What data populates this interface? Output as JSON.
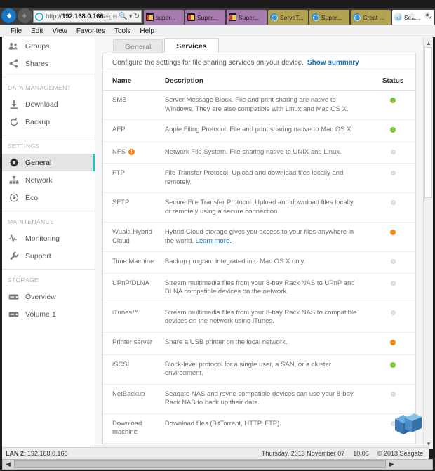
{
  "browser": {
    "back_label": "Back",
    "forward_label": "Forward",
    "url_scheme": "http://",
    "url_host": "192.168.0.166",
    "url_path": "/#general",
    "search_icon": "search-icon",
    "dropdown_icon": "chevron-down-icon",
    "refresh_icon": "refresh-icon",
    "tabs": [
      {
        "label": "super...",
        "color": "purple",
        "icon": "shopping-bag-icon",
        "active": false
      },
      {
        "label": "Super...",
        "color": "purple",
        "icon": "shopping-bag-icon",
        "active": false
      },
      {
        "label": "Super...",
        "color": "purple",
        "icon": "shopping-bag-icon",
        "active": false
      },
      {
        "label": "ServeT...",
        "color": "olive",
        "icon": "globe-icon",
        "active": false
      },
      {
        "label": "Super...",
        "color": "olive",
        "icon": "globe-icon",
        "active": false
      },
      {
        "label": "Great ...",
        "color": "olive",
        "icon": "globe-icon",
        "active": false
      },
      {
        "label": "Sea...",
        "color": "white",
        "icon": "globe-icon",
        "active": true,
        "close": "×"
      }
    ],
    "tools": [
      {
        "name": "home-icon",
        "label": "Home"
      },
      {
        "name": "favorites-star-icon",
        "label": "Favorites"
      },
      {
        "name": "settings-gear-icon",
        "label": "Tools"
      }
    ],
    "menu": [
      "File",
      "Edit",
      "View",
      "Favorites",
      "Tools",
      "Help"
    ]
  },
  "sidebar": {
    "items": [
      {
        "type": "item",
        "label": "Groups",
        "icon": "groups-icon",
        "selected": false
      },
      {
        "type": "item",
        "label": "Shares",
        "icon": "share-icon",
        "selected": false
      },
      {
        "type": "sep"
      },
      {
        "type": "group",
        "label": "DATA MANAGEMENT"
      },
      {
        "type": "item",
        "label": "Download",
        "icon": "download-icon",
        "selected": false
      },
      {
        "type": "item",
        "label": "Backup",
        "icon": "backup-icon",
        "selected": false
      },
      {
        "type": "sep"
      },
      {
        "type": "group",
        "label": "SETTINGS"
      },
      {
        "type": "item",
        "label": "General",
        "icon": "gear-icon",
        "selected": true
      },
      {
        "type": "item",
        "label": "Network",
        "icon": "network-icon",
        "selected": false
      },
      {
        "type": "item",
        "label": "Eco",
        "icon": "eco-icon",
        "selected": false
      },
      {
        "type": "sep"
      },
      {
        "type": "group",
        "label": "MAINTENANCE"
      },
      {
        "type": "item",
        "label": "Monitoring",
        "icon": "monitoring-icon",
        "selected": false
      },
      {
        "type": "item",
        "label": "Support",
        "icon": "wrench-icon",
        "selected": false
      },
      {
        "type": "sep"
      },
      {
        "type": "group",
        "label": "STORAGE"
      },
      {
        "type": "item",
        "label": "Overview",
        "icon": "storage-icon",
        "selected": false
      },
      {
        "type": "item",
        "label": "Volume 1",
        "icon": "storage-icon",
        "selected": false
      }
    ]
  },
  "main": {
    "tabs": [
      {
        "label": "General",
        "active": false
      },
      {
        "label": "Services",
        "active": true
      }
    ],
    "description": "Configure the settings for file sharing services on your device.",
    "summary_link": "Show summary",
    "table": {
      "headers": [
        "Name",
        "Description",
        "Status"
      ],
      "rows": [
        {
          "name": "SMB",
          "description": "Server Message Block. File and print sharing are native to Windows. They are also compatible with Linux and Mac OS X.",
          "status": "green"
        },
        {
          "name": "AFP",
          "description": "Apple Filing Protocol. File and print sharing native to Mac OS X.",
          "status": "green"
        },
        {
          "name": "NFS",
          "warning": "!",
          "description": "Network File System. File sharing native to UNIX and Linux.",
          "status": "grey"
        },
        {
          "name": "FTP",
          "description": "File Transfer Protocol. Upload and download files locally and remotely.",
          "status": "grey"
        },
        {
          "name": "SFTP",
          "description": "Secure File Transfer Protocol. Upload and download files locally or remotely using a secure connection.",
          "status": "grey"
        },
        {
          "name": "Wuala Hybrid Cloud",
          "description": "Hybrid Cloud storage gives you access to your files anywhere in the world.",
          "link": "Learn more.",
          "status": "orange"
        },
        {
          "name": "Time Machine",
          "description": "Backup program integrated into Mac OS X only.",
          "status": "grey"
        },
        {
          "name": "UPnP/DLNA",
          "description": "Stream multimedia files from your 8-bay Rack NAS to UPnP and DLNA compatible devices on the network.",
          "status": "grey"
        },
        {
          "name": "iTunes™",
          "description": "Stream multimedia files from your 8-bay Rack NAS to compatible devices on the network using iTunes.",
          "status": "grey"
        },
        {
          "name": "Printer server",
          "description": "Share a USB printer on the local network.",
          "status": "orange"
        },
        {
          "name": "iSCSI",
          "description": "Block-level protocol for a single user, a SAN, or a cluster environment.",
          "status": "green"
        },
        {
          "name": "NetBackup",
          "description": "Seagate NAS and rsync-compatible devices can use your 8-bay Rack NAS to back up their data.",
          "status": "grey"
        },
        {
          "name": "Download machine",
          "description": "Download files (BitTorrent, HTTP, FTP).",
          "status": "grey"
        }
      ]
    }
  },
  "status_bar": {
    "lan_label": "LAN 2",
    "lan_value": ": 192.168.0.166",
    "date": "Thursday, 2013 November 07",
    "time": "10:06",
    "copyright": "© 2013 Seagate"
  },
  "watermark": {
    "name": "tweaktown-logo",
    "text": "TT"
  },
  "colors": {
    "accent_teal": "#27c2c8",
    "status_green": "#7cc242",
    "status_orange": "#f08a18",
    "status_grey": "#e2e2e2",
    "link_blue": "#1a6fb8",
    "tab_purple": "#a87bb0",
    "tab_olive": "#b3a24f"
  }
}
